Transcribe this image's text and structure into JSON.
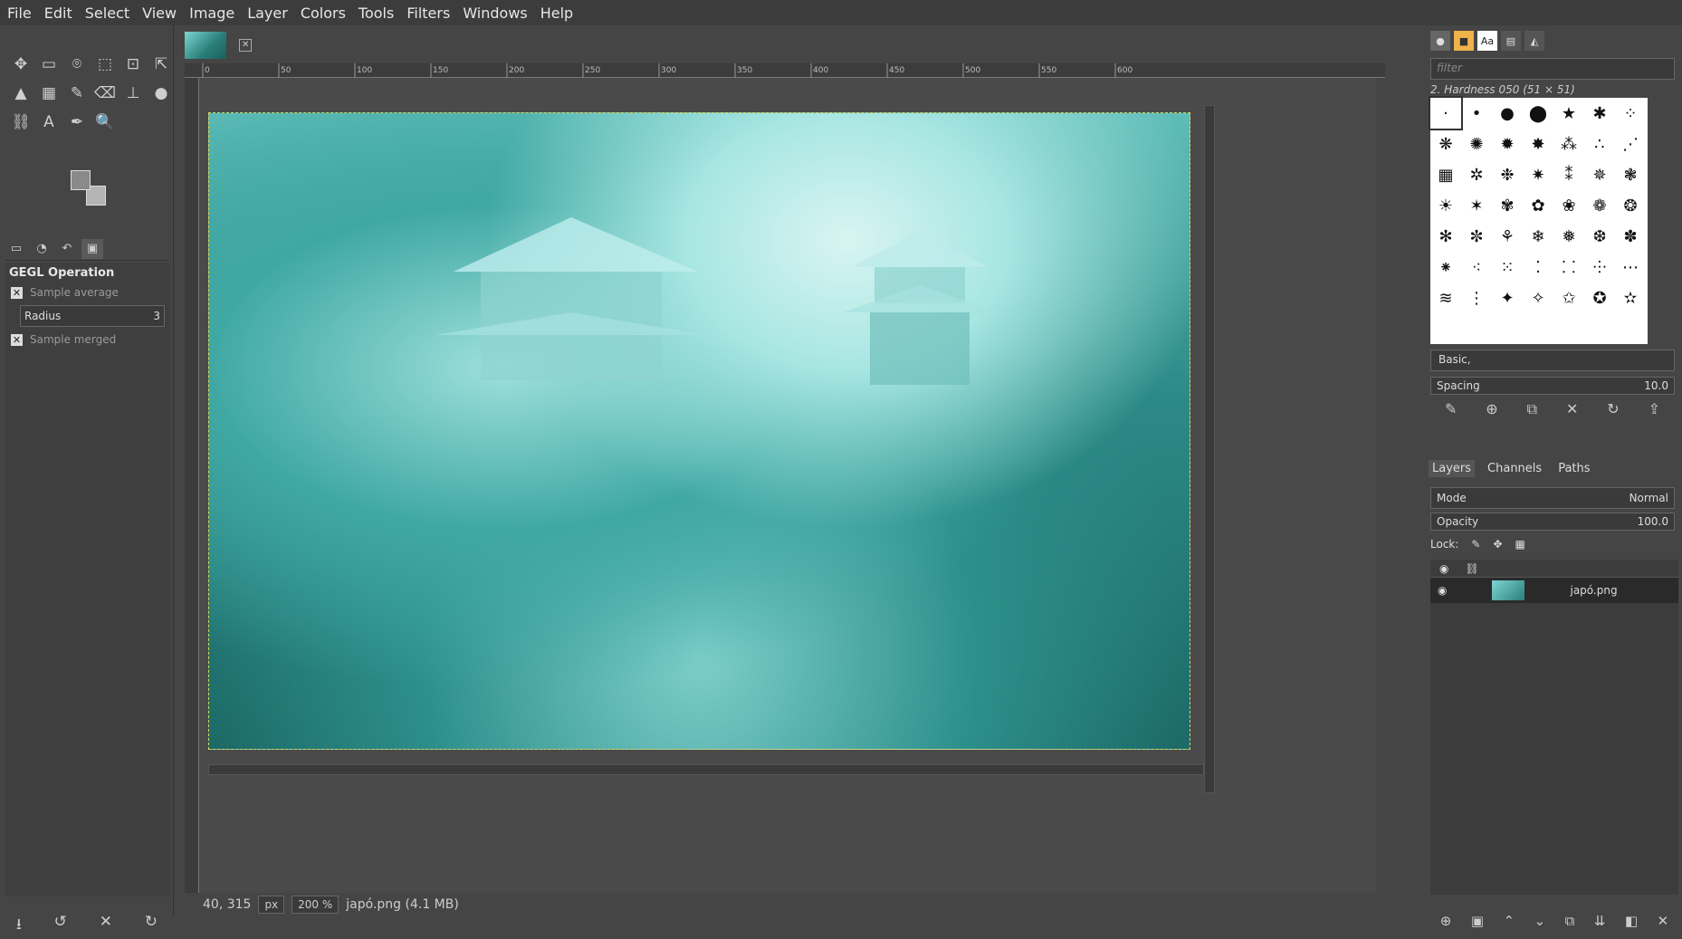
{
  "menu": [
    "File",
    "Edit",
    "Select",
    "View",
    "Image",
    "Layer",
    "Colors",
    "Tools",
    "Filters",
    "Windows",
    "Help"
  ],
  "toolbox": {
    "tools": [
      "✥",
      "▭",
      "⌾",
      "⬚",
      "⊡",
      "⇱",
      "▲",
      "▦",
      "✎",
      "⌫",
      "⊥",
      "●",
      "⛓",
      "A",
      "✒",
      "🔍"
    ],
    "options_title": "GEGL Operation",
    "sample_average": "Sample average",
    "radius_label": "Radius",
    "radius_value": "3",
    "sample_merged": "Sample merged",
    "bottom_icons": [
      "⭳",
      "↺",
      "✕",
      "↻"
    ]
  },
  "image_window": {
    "ruler_labels": [
      "0",
      "50",
      "100",
      "150",
      "200",
      "250",
      "300",
      "350",
      "400",
      "450",
      "500",
      "550",
      "600"
    ],
    "status_coords": "40, 315",
    "unit": "px",
    "zoom": "200 %",
    "file_info": "japó.png (4.1 MB)"
  },
  "right_dock": {
    "filter_placeholder": "filter",
    "brush_name": "2. Hardness 050 (51 × 51)",
    "brush_set": "Basic,",
    "spacing_label": "Spacing",
    "spacing_value": "10.0",
    "layers_tab": "Layers",
    "channels_tab": "Channels",
    "paths_tab": "Paths",
    "mode_label": "Mode",
    "mode_value": "Normal",
    "opacity_label": "Opacity",
    "opacity_value": "100.0",
    "lock_label": "Lock:",
    "layer_name": "japó.png"
  }
}
